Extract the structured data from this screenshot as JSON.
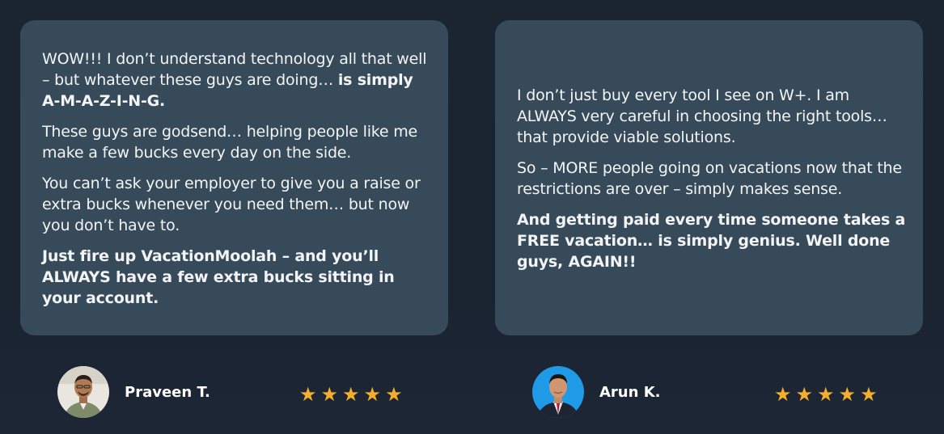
{
  "testimonials": [
    {
      "paragraphs": [
        {
          "text": "WOW!!! I don’t understand technology all that well – but whatever these guys are doing… ",
          "bold": "is simply A-M-A-Z-I-N-G."
        },
        {
          "text": "These guys are godsend… helping people like me make a few bucks every day on the side."
        },
        {
          "text": "You can’t ask your employer to give you a raise or extra bucks whenever you need them… but now you don’t have to."
        },
        {
          "bold": "Just fire up VacationMoolah – and you’ll ALWAYS have a few extra bucks sitting in your account."
        }
      ],
      "author": "Praveen T.",
      "rating": 5,
      "stars": "★★★★★"
    },
    {
      "paragraphs": [
        {
          "text": "I don’t just buy every tool I see on W+. I am ALWAYS very careful in choosing the right tools… that provide viable solutions."
        },
        {
          "text": "So – MORE people going on vacations now that the restrictions are over – simply makes sense."
        },
        {
          "bold": "And getting paid every time someone takes a FREE vacation… is simply genius. Well done guys, AGAIN!!"
        }
      ],
      "author": "Arun K.",
      "rating": 5,
      "stars": "★★★★★"
    }
  ],
  "colors": {
    "background": "#1b2431",
    "card": "#374a5a",
    "star": "#f5ad2c"
  }
}
